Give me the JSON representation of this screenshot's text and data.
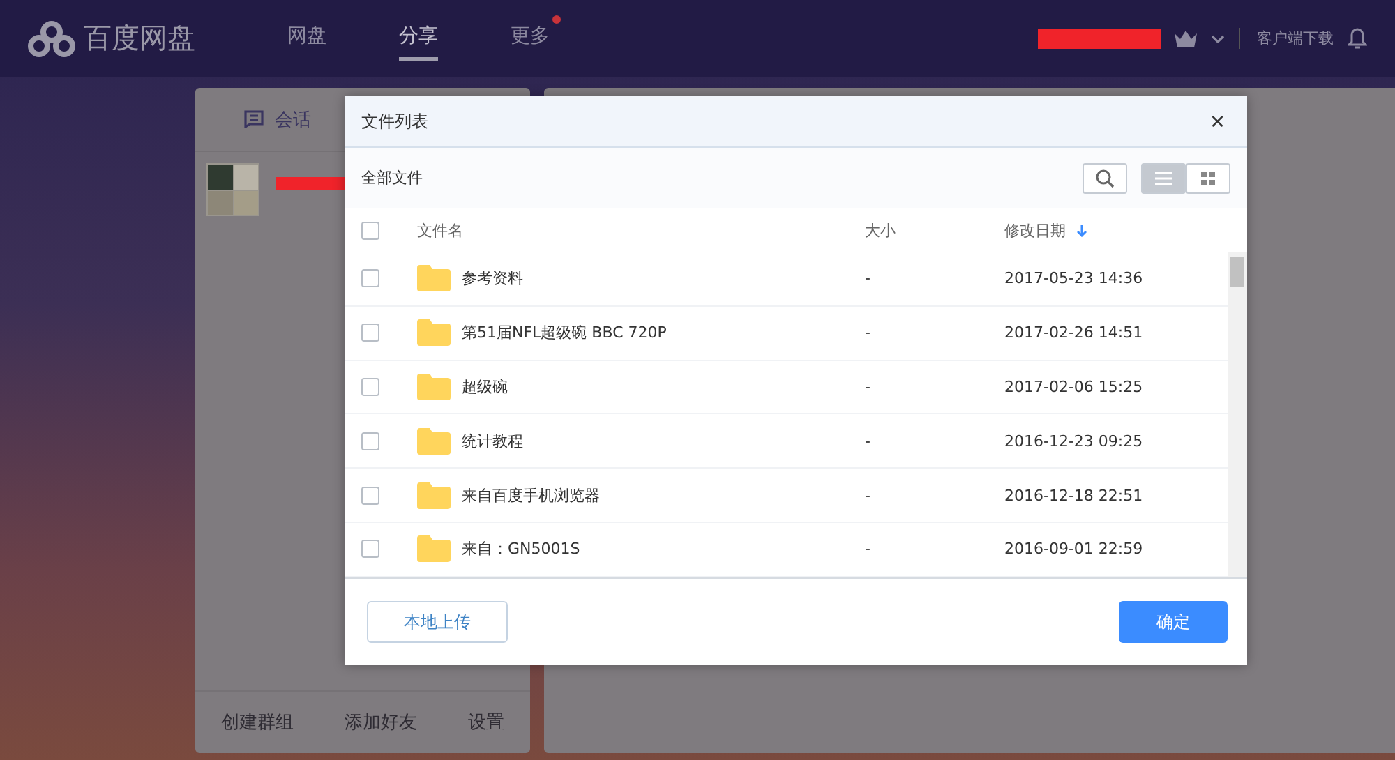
{
  "app": {
    "logo": "百度网盘"
  },
  "nav": [
    {
      "label": "网盘",
      "selected": false,
      "badge": false
    },
    {
      "label": "分享",
      "selected": true,
      "badge": false
    },
    {
      "label": "更多",
      "selected": false,
      "badge": true
    }
  ],
  "header_right": {
    "download_link": "客户端下载"
  },
  "sidebar": {
    "tab": "会话",
    "actions": [
      "创建群组",
      "添加好友",
      "设置"
    ]
  },
  "dialog": {
    "title": "文件列表",
    "close": "×",
    "breadcrumb": "全部文件",
    "view_modes": [
      {
        "kind": "list",
        "selected": true
      },
      {
        "kind": "grid",
        "selected": false
      }
    ],
    "select_all": {
      "checked": false
    },
    "columns": [
      "文件名",
      "大小",
      "修改日期"
    ],
    "rows": [
      {
        "name": "参考资料",
        "size": "-",
        "date": "2017-05-23 14:36",
        "checked": false
      },
      {
        "name": "第51届NFL超级碗 BBC 720P",
        "size": "-",
        "date": "2017-02-26 14:51",
        "checked": false
      },
      {
        "name": "超级碗",
        "size": "-",
        "date": "2017-02-06 15:25",
        "checked": false
      },
      {
        "name": "统计教程",
        "size": "-",
        "date": "2016-12-23 09:25",
        "checked": false
      },
      {
        "name": "来自百度手机浏览器",
        "size": "-",
        "date": "2016-12-18 22:51",
        "checked": false
      },
      {
        "name": "来自：GN5001S",
        "size": "-",
        "date": "2016-09-01 22:59",
        "checked": false
      }
    ],
    "upload_button": "本地上传",
    "confirm_button": "确定"
  }
}
